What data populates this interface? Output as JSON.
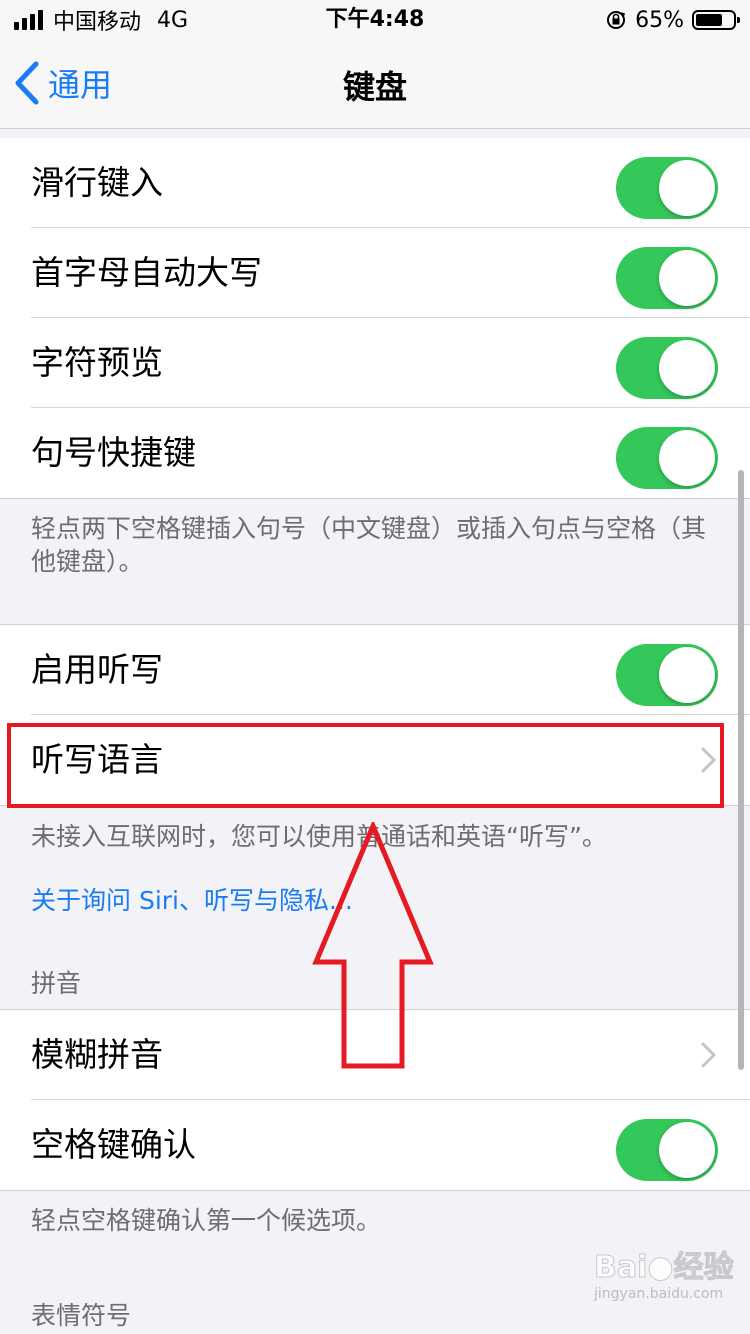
{
  "status_bar": {
    "carrier": "中国移动",
    "network": "4G",
    "time": "下午4:48",
    "battery_percent": "65%",
    "battery_level": 0.65,
    "icons": [
      "signal-icon",
      "orientation-lock-icon",
      "battery-icon"
    ]
  },
  "nav": {
    "back_label": "通用",
    "title": "键盘"
  },
  "group1": {
    "rows": [
      {
        "label": "滑行键入",
        "on": true
      },
      {
        "label": "首字母自动大写",
        "on": true
      },
      {
        "label": "字符预览",
        "on": true
      },
      {
        "label": "句号快捷键",
        "on": true
      }
    ],
    "footer": "轻点两下空格键插入句号（中文键盘）或插入句点与空格（其他键盘）。"
  },
  "group2": {
    "rows": [
      {
        "label": "启用听写",
        "on": true
      },
      {
        "label": "听写语言",
        "chevron": true
      }
    ],
    "footer": "未接入互联网时，您可以使用普通话和英语“听写”。",
    "link": "关于询问 Siri、听写与隐私..."
  },
  "group3": {
    "header": "拼音",
    "rows": [
      {
        "label": "模糊拼音",
        "chevron": true
      },
      {
        "label": "空格键确认",
        "on": true
      }
    ],
    "footer": "轻点空格键确认第一个候选项。"
  },
  "group4": {
    "header": "表情符号"
  },
  "colors": {
    "accent": "#1a7cf5",
    "toggle_on": "#34c759",
    "annotation": "#e51a22"
  },
  "watermark": {
    "brand": "Bai",
    "brand_suffix": "经验",
    "url": "jingyan.baidu.com"
  }
}
